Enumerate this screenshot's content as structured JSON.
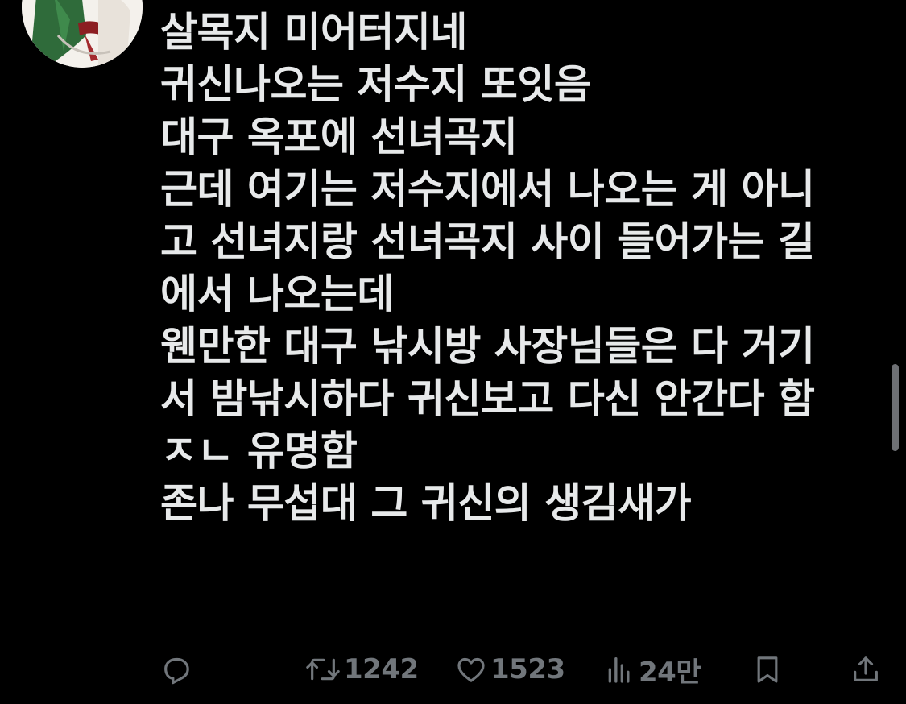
{
  "tweet": {
    "lines": [
      "살목지 미어터지네",
      "귀신나오는 저수지 또잇음",
      "대구 옥포에 선녀곡지",
      "근데 여기는 저수지에서 나오는 게 아니",
      "고 선녀지랑 선녀곡지 사이 들어가는 길",
      "에서 나오는데",
      "웬만한 대구 낚시방 사장님들은 다 거기",
      "서 밤낚시하다 귀신보고 다신 안간다 함",
      "ㅈㄴ 유명함",
      "존나 무섭대 그 귀신의 생김새가"
    ]
  },
  "actions": {
    "reply_icon": "reply-icon",
    "retweet_icon": "retweet-icon",
    "retweet_count": "1242",
    "like_icon": "heart-icon",
    "like_count": "1523",
    "views_icon": "bar-chart-icon",
    "views_count": "24만",
    "bookmark_icon": "bookmark-icon",
    "share_icon": "share-icon"
  },
  "colors": {
    "background": "#000000",
    "text": "#e7e9ea",
    "muted": "#71767b"
  }
}
